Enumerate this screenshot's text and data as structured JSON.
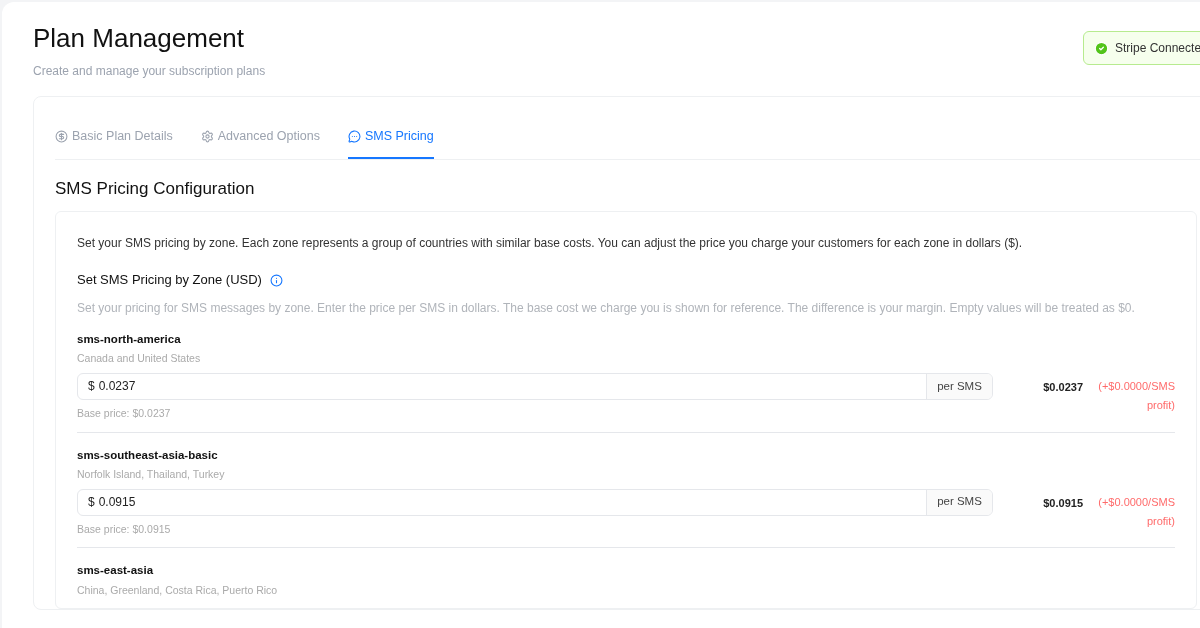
{
  "page": {
    "title": "Plan Management",
    "subtitle": "Create and manage your subscription plans"
  },
  "stripe_badge": {
    "label": "Stripe Connecte",
    "connected": true
  },
  "tabs": [
    {
      "label": "Basic Plan Details",
      "kind": "dollar",
      "selected": false
    },
    {
      "label": "Advanced Options",
      "kind": "gear",
      "selected": false
    },
    {
      "label": "SMS Pricing",
      "kind": "chat",
      "selected": true
    }
  ],
  "section": {
    "title": "SMS Pricing Configuration",
    "intro": "Set your SMS pricing by zone. Each zone represents a group of countries with similar base costs. You can adjust the price you charge your customers for each zone in dollars ($).",
    "heading": "Set SMS Pricing by Zone (USD)",
    "description": "Set your pricing for SMS messages by zone. Enter the price per SMS in dollars. The base cost we charge you is shown for reference. The difference is your margin. Empty values will be treated as $0."
  },
  "zones": [
    {
      "name": "sms-north-america",
      "countries": "Canada and United States",
      "currency": "$",
      "value": "0.0237",
      "unit": "per SMS",
      "base_price": "Base price: $0.0237",
      "price": "$0.0237",
      "profit": "(+$0.0000/SMS profit)"
    },
    {
      "name": "sms-southeast-asia-basic",
      "countries": "Norfolk Island, Thailand, Turkey",
      "currency": "$",
      "value": "0.0915",
      "unit": "per SMS",
      "base_price": "Base price: $0.0915",
      "price": "$0.0915",
      "profit": "(+$0.0000/SMS profit)"
    },
    {
      "name": "sms-east-asia",
      "countries": "China, Greenland, Costa Rica, Puerto Rico"
    }
  ]
}
